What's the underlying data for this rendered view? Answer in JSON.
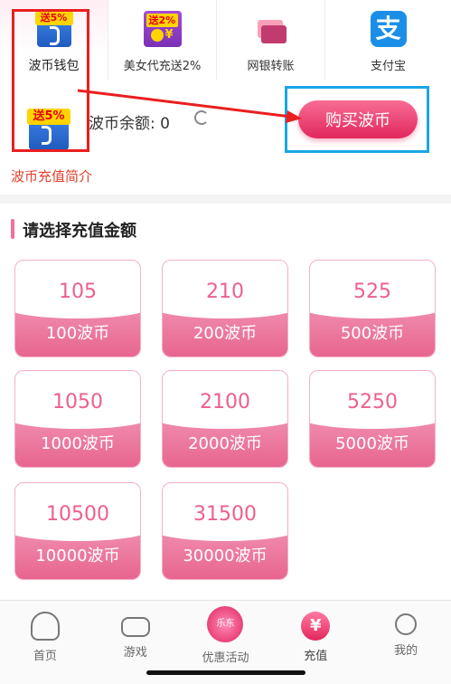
{
  "tabs": [
    {
      "label": "波币钱包",
      "badge": "送5%",
      "icon": "wallet-icon"
    },
    {
      "label": "美女代充送2%",
      "badge": "送2%",
      "icon": "beauty-recharge-icon"
    },
    {
      "label": "网银转账",
      "icon": "bank-card-icon"
    },
    {
      "label": "支付宝",
      "glyph": "支",
      "icon": "alipay-icon"
    }
  ],
  "wallet": {
    "badge": "送5%",
    "balance_label": "波币余额: 0",
    "buy_button": "购买波币",
    "intro_link": "波币充值简介"
  },
  "section": {
    "title": "请选择充值金额"
  },
  "amounts": [
    {
      "price": "105",
      "coins": "100波币"
    },
    {
      "price": "210",
      "coins": "200波币"
    },
    {
      "price": "525",
      "coins": "500波币"
    },
    {
      "price": "1050",
      "coins": "1000波币"
    },
    {
      "price": "2100",
      "coins": "2000波币"
    },
    {
      "price": "5250",
      "coins": "5000波币"
    },
    {
      "price": "10500",
      "coins": "10000波币"
    },
    {
      "price": "31500",
      "coins": "30000波币"
    }
  ],
  "nav": [
    {
      "label": "首页",
      "icon": "home-icon"
    },
    {
      "label": "游戏",
      "icon": "gamepad-icon"
    },
    {
      "label": "优惠活动",
      "icon": "promo-icon",
      "badge": "乐东"
    },
    {
      "label": "充值",
      "icon": "recharge-icon",
      "glyph": "¥"
    },
    {
      "label": "我的",
      "icon": "profile-icon"
    }
  ],
  "colors": {
    "accent": "#e2275c",
    "highlight_red": "#ea1f1f",
    "highlight_blue": "#1aa6e6"
  }
}
